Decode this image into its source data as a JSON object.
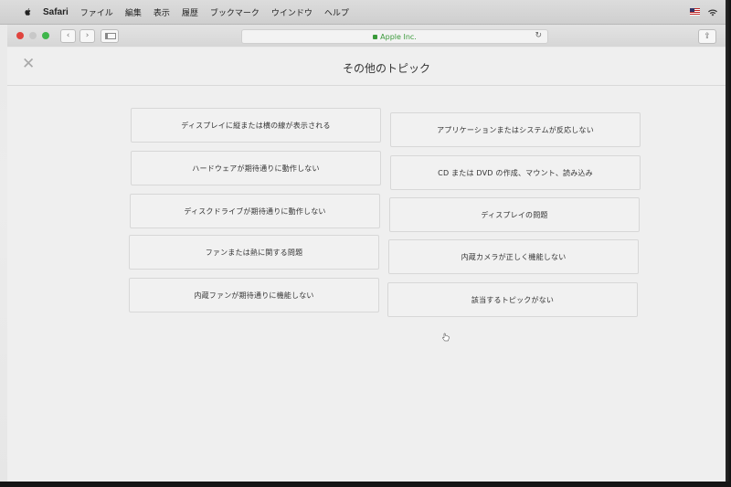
{
  "menubar": {
    "app_name": "Safari",
    "items": [
      "ファイル",
      "編集",
      "表示",
      "履歴",
      "ブックマーク",
      "ウインドウ",
      "ヘルプ"
    ]
  },
  "browser": {
    "url": "Apple Inc.",
    "back_icon": "chevron-left-icon",
    "forward_icon": "chevron-right-icon",
    "reload_icon": "reload-icon",
    "share_icon": "share-icon"
  },
  "page": {
    "title": "その他のトピック",
    "close_icon": "close-icon",
    "topics_left": [
      "ディスプレイに縦または横の線が表示される",
      "ハードウェアが期待通りに動作しない",
      "ディスクドライブが期待通りに動作しない",
      "ファンまたは熱に関する問題",
      "内蔵ファンが期待通りに機能しない"
    ],
    "topics_right": [
      "アプリケーションまたはシステムが反応しない",
      "CD または DVD の作成、マウント、読み込み",
      "ディスプレイの問題",
      "内蔵カメラが正しく機能しない",
      "該当するトピックがない"
    ]
  },
  "colors": {
    "traffic_red": "#e0443e",
    "traffic_green": "#3fb64b",
    "secure_green": "#3a9a3a"
  }
}
